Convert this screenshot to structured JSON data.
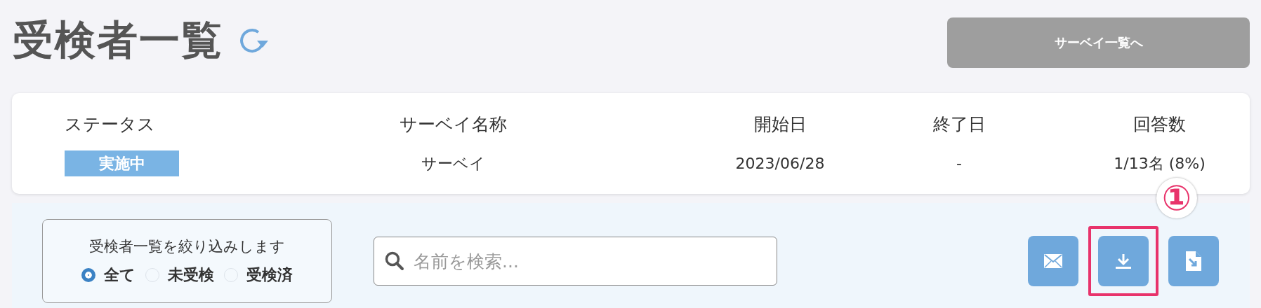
{
  "header": {
    "title": "受検者一覧",
    "survey_list_button": "サーベイ一覧へ"
  },
  "summary": {
    "columns": [
      {
        "label": "ステータス",
        "kind": "badge",
        "value": "実施中"
      },
      {
        "label": "サーベイ名称",
        "kind": "text",
        "value": "サーベイ"
      },
      {
        "label": "開始日",
        "kind": "text",
        "value": "2023/06/28"
      },
      {
        "label": "終了日",
        "kind": "text",
        "value": "-"
      },
      {
        "label": "回答数",
        "kind": "text",
        "value": "1/13名 (8%)"
      }
    ]
  },
  "filter": {
    "legend": "受検者一覧を絞り込みします",
    "options": [
      {
        "label": "全て",
        "selected": true
      },
      {
        "label": "未受検",
        "selected": false
      },
      {
        "label": "受検済",
        "selected": false
      }
    ]
  },
  "search": {
    "placeholder": "名前を検索..."
  },
  "actions": [
    {
      "kind": "mail",
      "highlighted": false
    },
    {
      "kind": "download",
      "highlighted": true,
      "annotation": "①"
    },
    {
      "kind": "file-export",
      "highlighted": false
    }
  ]
}
